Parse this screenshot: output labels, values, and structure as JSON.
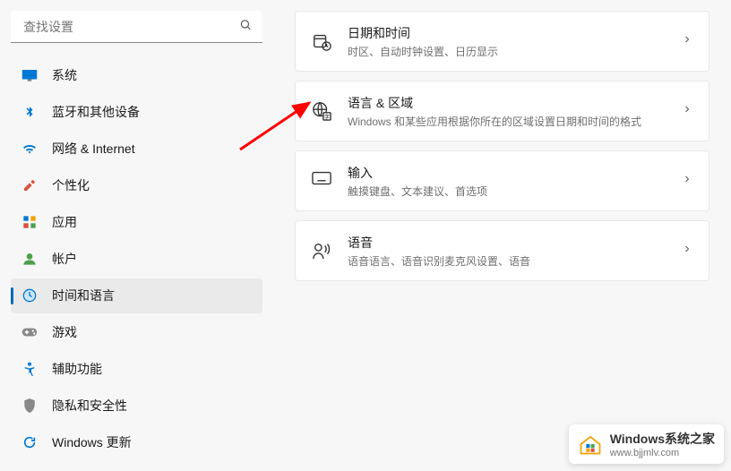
{
  "search": {
    "placeholder": "查找设置"
  },
  "sidebar": {
    "items": [
      {
        "label": "系统",
        "icon": "system"
      },
      {
        "label": "蓝牙和其他设备",
        "icon": "bluetooth"
      },
      {
        "label": "网络 & Internet",
        "icon": "network"
      },
      {
        "label": "个性化",
        "icon": "personalize"
      },
      {
        "label": "应用",
        "icon": "apps"
      },
      {
        "label": "帐户",
        "icon": "account"
      },
      {
        "label": "时间和语言",
        "icon": "time-language",
        "active": true
      },
      {
        "label": "游戏",
        "icon": "gaming"
      },
      {
        "label": "辅助功能",
        "icon": "accessibility"
      },
      {
        "label": "隐私和安全性",
        "icon": "privacy"
      },
      {
        "label": "Windows 更新",
        "icon": "update"
      }
    ]
  },
  "main": {
    "cards": [
      {
        "title": "日期和时间",
        "sub": "时区、自动时钟设置、日历显示",
        "icon": "datetime"
      },
      {
        "title": "语言 & 区域",
        "sub": "Windows 和某些应用根据你所在的区域设置日期和时间的格式",
        "icon": "language-region"
      },
      {
        "title": "输入",
        "sub": "触摸键盘、文本建议、首选项",
        "icon": "typing"
      },
      {
        "title": "语音",
        "sub": "语音语言、语音识别麦克风设置、语音",
        "icon": "speech"
      }
    ]
  },
  "watermark": {
    "text": "Windows系统之家",
    "url": "www.bjjmlv.com"
  }
}
